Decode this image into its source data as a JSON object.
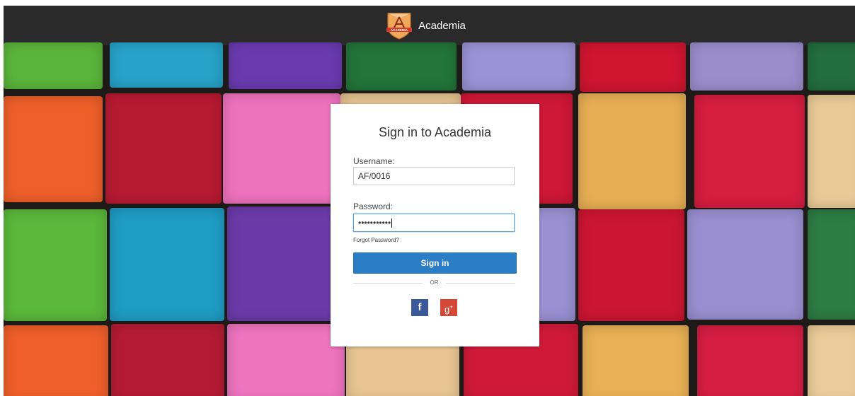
{
  "app": {
    "title": "Academia",
    "logo_text": "ACADEMIA",
    "logo_icon": "academia-shield-logo"
  },
  "colors": {
    "topbar": "#2a2a2a",
    "primary_button": "#2b7dc6",
    "facebook": "#3b5998",
    "google_plus": "#d34836",
    "input_focus": "#5aa0d8"
  },
  "login": {
    "title": "Sign in to Academia",
    "username_label": "Username:",
    "username_value": "AF/0016",
    "password_label": "Password:",
    "password_value": "•••••••••••",
    "forgot_label": "Forgot Password?",
    "signin_label": "Sign in",
    "or_label": "OR",
    "facebook_glyph": "f",
    "google_glyph": "g",
    "google_plus_glyph": "+",
    "social_icons": [
      "facebook-icon",
      "google-plus-icon"
    ]
  }
}
